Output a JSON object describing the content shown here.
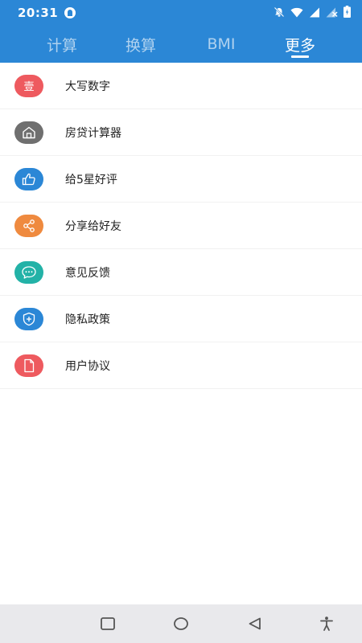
{
  "status_bar": {
    "time": "20:31"
  },
  "tabs": [
    {
      "label": "计算",
      "active": false
    },
    {
      "label": "换算",
      "active": false
    },
    {
      "label": "BMI",
      "active": false
    },
    {
      "label": "更多",
      "active": true
    }
  ],
  "menu": [
    {
      "label": "大写数字",
      "icon": "uppercase-number-icon",
      "icon_text": "壹",
      "color": "#ee5a5f"
    },
    {
      "label": "房贷计算器",
      "icon": "house-icon",
      "color": "#6f6f6f"
    },
    {
      "label": "给5星好评",
      "icon": "thumbs-up-icon",
      "color": "#2b87d6"
    },
    {
      "label": "分享给好友",
      "icon": "share-icon",
      "color": "#ef8a3f"
    },
    {
      "label": "意见反馈",
      "icon": "chat-bubble-icon",
      "color": "#23b2a7"
    },
    {
      "label": "隐私政策",
      "icon": "shield-icon",
      "color": "#2b87d6"
    },
    {
      "label": "用户协议",
      "icon": "document-icon",
      "color": "#ee5a5f"
    }
  ],
  "colors": {
    "primary": "#2b87d6",
    "nav_bar": "#e9e9ec",
    "divider": "#f1f1f1"
  },
  "nav_bar": {
    "icons": [
      "recents-square-icon",
      "home-circle-icon",
      "back-triangle-icon",
      "accessibility-icon"
    ]
  }
}
